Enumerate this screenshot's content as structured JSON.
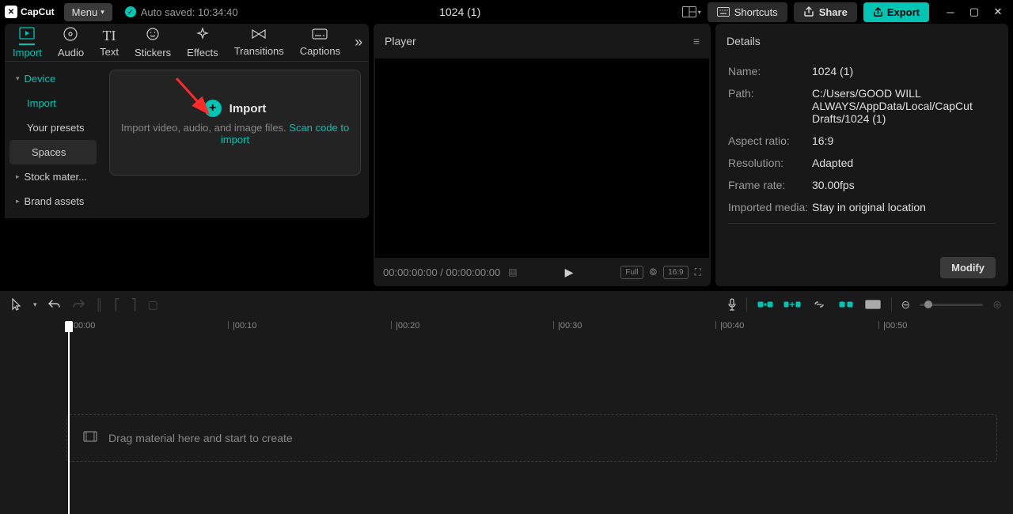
{
  "titlebar": {
    "logo": "CapCut",
    "menu": "Menu",
    "auto_saved": "Auto saved: 10:34:40",
    "project": "1024 (1)",
    "shortcuts": "Shortcuts",
    "share": "Share",
    "export": "Export"
  },
  "tabs": [
    {
      "label": "Import",
      "active": true
    },
    {
      "label": "Audio"
    },
    {
      "label": "Text"
    },
    {
      "label": "Stickers"
    },
    {
      "label": "Effects"
    },
    {
      "label": "Transitions"
    },
    {
      "label": "Captions"
    }
  ],
  "sidebar": {
    "device": "Device",
    "import": "Import",
    "presets": "Your presets",
    "spaces": "Spaces",
    "stock": "Stock mater...",
    "brand": "Brand assets"
  },
  "import_card": {
    "title": "Import",
    "desc_prefix": "Import video, audio, and image files. ",
    "scan_link": "Scan code to import"
  },
  "player": {
    "title": "Player",
    "time": "00:00:00:00 / 00:00:00:00",
    "full": "Full",
    "ratio": "16:9"
  },
  "details": {
    "title": "Details",
    "rows": [
      {
        "label": "Name:",
        "value": "1024 (1)"
      },
      {
        "label": "Path:",
        "value": "C:/Users/GOOD WILL ALWAYS/AppData/Local/CapCut Drafts/1024 (1)"
      },
      {
        "label": "Aspect ratio:",
        "value": "16:9"
      },
      {
        "label": "Resolution:",
        "value": "Adapted"
      },
      {
        "label": "Frame rate:",
        "value": "30.00fps"
      },
      {
        "label": "Imported media:",
        "value": "Stay in original location"
      }
    ],
    "modify": "Modify"
  },
  "timeline": {
    "ticks": [
      "00:00",
      "00:10",
      "00:20",
      "00:30",
      "00:40",
      "00:50"
    ],
    "drop_hint": "Drag material here and start to create"
  }
}
